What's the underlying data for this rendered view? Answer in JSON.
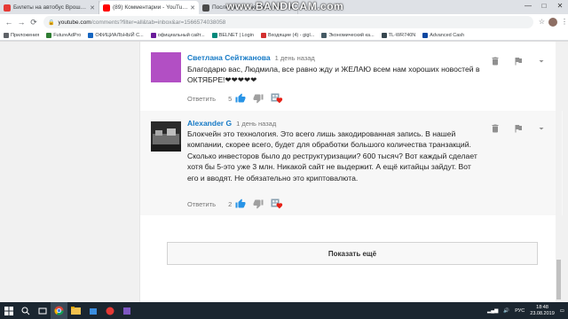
{
  "browser": {
    "tabs": [
      {
        "title": "Билеты на автобус Врошлее - С",
        "favicon_color": "#e53935",
        "active": false
      },
      {
        "title": "(89) Комментарии - YouTube",
        "favicon_color": "#ff0000",
        "active": true
      },
      {
        "title": "Последние новости, в июле, цветут ро",
        "favicon_color": "#4a4a4a",
        "active": false
      }
    ],
    "new_tab_glyph": "+",
    "overlay_watermark": "www.BANDICAM.com",
    "window_controls": [
      "—",
      "□",
      "✕"
    ],
    "url_host": "youtube.com",
    "url_path": "/comments?filter=all&tab=inbox&ar=1566574038058",
    "bookmarks": [
      {
        "label": "Приложения",
        "color": "#5f6368"
      },
      {
        "label": "FutureAdPro",
        "color": "#2e7d32"
      },
      {
        "label": "ОФИЦИАЛЬНЫЙ С...",
        "color": "#1565c0"
      },
      {
        "label": "официальный сайт...",
        "color": "#6a1b9a"
      },
      {
        "label": "BELNET | Login",
        "color": "#00897b"
      },
      {
        "label": "Входящие (4) - gigl...",
        "color": "#d32f2f"
      },
      {
        "label": "Экономический ка...",
        "color": "#455a64"
      },
      {
        "label": "TL-WR740N",
        "color": "#37474f"
      },
      {
        "label": "Advanced Cash",
        "color": "#0d47a1"
      }
    ]
  },
  "comments": [
    {
      "author": "Светлана Сейтжанова",
      "time": "1 день назад",
      "text": "Благодарю вас, Людмила, все равно жду и ЖЕЛАЮ всем нам хороших новостей в ОКТЯБРЕ!❤❤❤❤❤",
      "reply_label": "Ответить",
      "likes": "5",
      "avatar_color": "#9c27b0"
    },
    {
      "author": "Alexander G",
      "time": "1 день назад",
      "text": "Блокчейн это технология. Это всего лишь закодированная запись. В нашей компании, скорее всего, будет для обработки большого количества транзакций. Сколько инвесторов было до реструктуризации? 600 тысяч? Вот каждый сделает хотя бы 5-это уже 3 млн. Никакой сайт не выдержит. А ещё китайцы зайдут. Вот его и вводят. Не обязательно это криптовалюта.",
      "reply_label": "Ответить",
      "likes": "2",
      "avatar_color": "#3e3e3e"
    }
  ],
  "load_more_label": "Показать ещё",
  "taskbar": {
    "language": "РУС",
    "time": "18:48",
    "date": "23.08.2019"
  },
  "colors": {
    "link_blue": "#167ac6",
    "like_blue": "#2793e6",
    "heart_red": "#e62117"
  }
}
